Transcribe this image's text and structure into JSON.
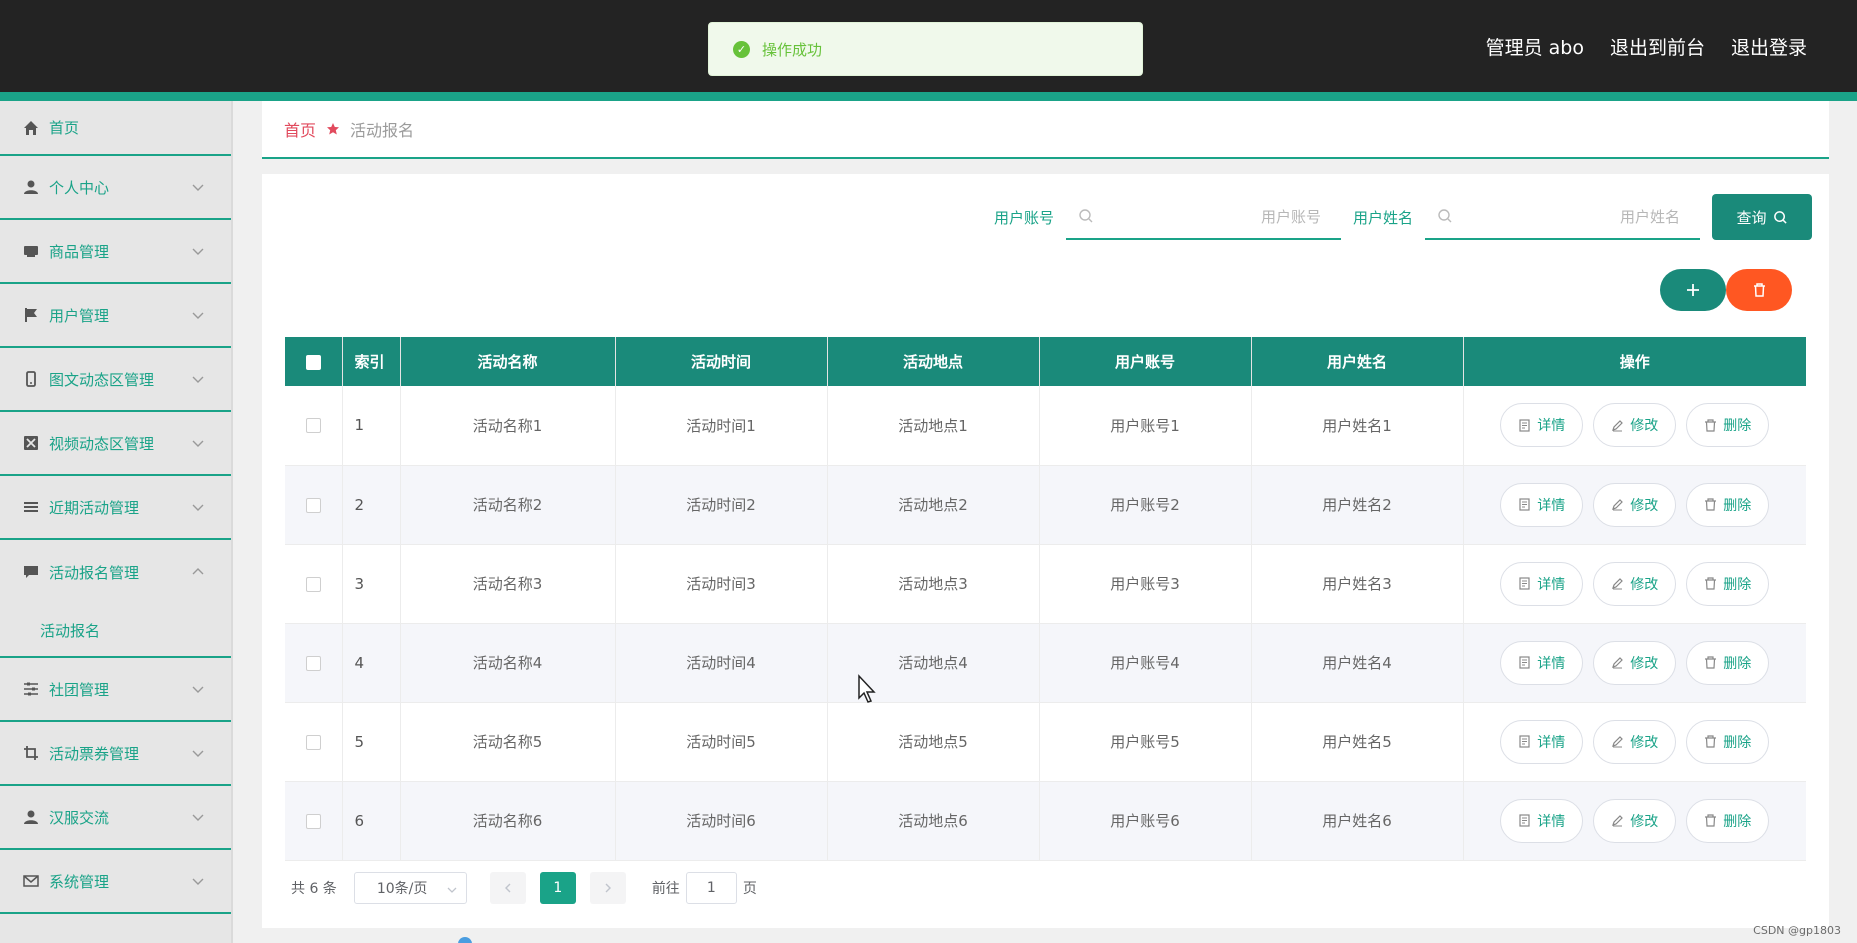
{
  "header": {
    "admin_label": "管理员 abo",
    "back_to_front": "退出到前台",
    "logout": "退出登录"
  },
  "toast": {
    "message": "操作成功",
    "status_color": "#67c23a"
  },
  "sidebar": {
    "items": [
      {
        "label": "首页",
        "icon": "home-icon"
      },
      {
        "label": "个人中心",
        "icon": "user-icon"
      },
      {
        "label": "商品管理",
        "icon": "product-icon"
      },
      {
        "label": "用户管理",
        "icon": "flag-icon"
      },
      {
        "label": "图文动态区管理",
        "icon": "phone-icon"
      },
      {
        "label": "视频动态区管理",
        "icon": "video-icon"
      },
      {
        "label": "近期活动管理",
        "icon": "list-icon"
      },
      {
        "label": "活动报名管理",
        "icon": "chat-icon"
      },
      {
        "label": "社团管理",
        "icon": "sliders-icon"
      },
      {
        "label": "活动票券管理",
        "icon": "crop-icon"
      },
      {
        "label": "汉服交流",
        "icon": "person-icon"
      },
      {
        "label": "系统管理",
        "icon": "mail-icon"
      }
    ],
    "sub_item": "活动报名"
  },
  "breadcrumb": {
    "home": "首页",
    "current": "活动报名"
  },
  "search": {
    "account_label": "用户账号",
    "account_placeholder": "用户账号",
    "name_label": "用户姓名",
    "name_placeholder": "用户姓名",
    "query_button": "查询"
  },
  "table": {
    "headers": [
      "索引",
      "活动名称",
      "活动时间",
      "活动地点",
      "用户账号",
      "用户姓名",
      "操作"
    ],
    "rows": [
      [
        "1",
        "活动名称1",
        "活动时间1",
        "活动地点1",
        "用户账号1",
        "用户姓名1"
      ],
      [
        "2",
        "活动名称2",
        "活动时间2",
        "活动地点2",
        "用户账号2",
        "用户姓名2"
      ],
      [
        "3",
        "活动名称3",
        "活动时间3",
        "活动地点3",
        "用户账号3",
        "用户姓名3"
      ],
      [
        "4",
        "活动名称4",
        "活动时间4",
        "活动地点4",
        "用户账号4",
        "用户姓名4"
      ],
      [
        "5",
        "活动名称5",
        "活动时间5",
        "活动地点5",
        "用户账号5",
        "用户姓名5"
      ],
      [
        "6",
        "活动名称6",
        "活动时间6",
        "活动地点6",
        "用户账号6",
        "用户姓名6"
      ]
    ],
    "actions": {
      "detail": "详情",
      "edit": "修改",
      "delete": "删除"
    }
  },
  "pagination": {
    "total": "共 6 条",
    "page_size": "10条/页",
    "current_page": "1",
    "goto_label": "前往",
    "goto_value": "1",
    "page_suffix": "页"
  },
  "watermark": "CSDN @gp1803",
  "colors": {
    "accent": "#1aa388",
    "button": "#1a8a7a",
    "danger": "#ff5722",
    "home_link": "#e14a5d"
  }
}
